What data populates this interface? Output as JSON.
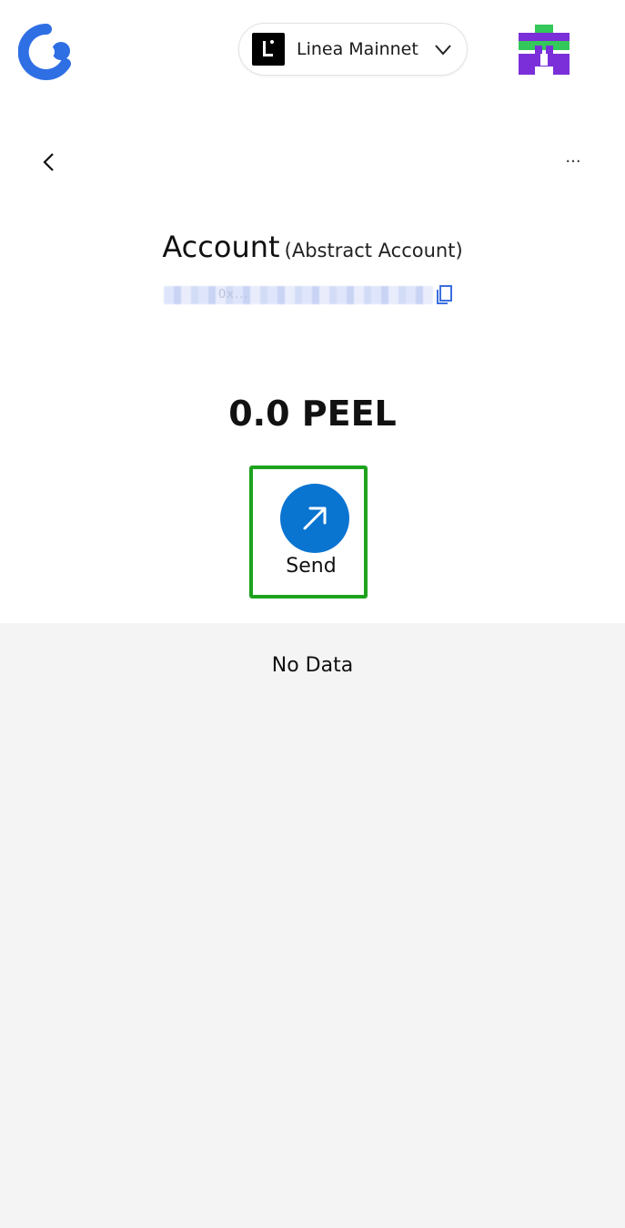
{
  "header": {
    "app_logo_icon": "c-brand-logo-icon",
    "network": {
      "name": "Linea Mainnet",
      "icon": "linea-logo-icon",
      "chevron_icon": "chevron-down-icon"
    },
    "avatar_icon": "pixel-avatar-icon"
  },
  "nav": {
    "back_icon": "chevron-left-icon",
    "more_label": "···"
  },
  "account": {
    "title": "Account",
    "type": "(Abstract Account)",
    "address_masked": "0x...",
    "copy_icon": "copy-icon"
  },
  "balance": {
    "value": "0.0 PEEL"
  },
  "actions": {
    "send_label": "Send",
    "send_icon": "arrow-up-right-icon"
  },
  "activity": {
    "empty_text": "No Data"
  },
  "colors": {
    "brand_blue": "#2f6fe4",
    "send_blue": "#0a74d1",
    "highlight_green": "#1ea31e",
    "panel_gray": "#f4f4f4",
    "avatar_purple": "#7b2fd9",
    "avatar_green": "#34c759"
  }
}
